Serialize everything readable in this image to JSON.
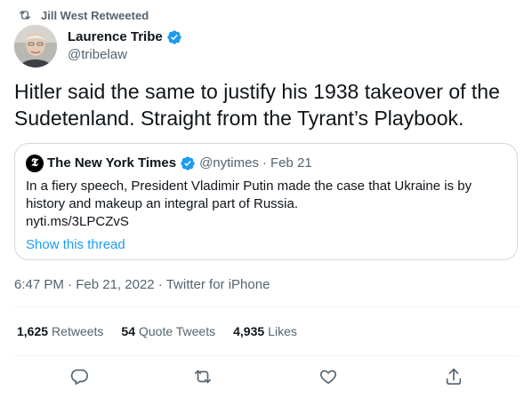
{
  "retweet_context": {
    "text": "Jill West Retweeted",
    "icon": "retweet-icon"
  },
  "author": {
    "name": "Laurence Tribe",
    "handle": "@tribelaw",
    "verified": true,
    "avatar_icon": "avatar-photo"
  },
  "tweet": {
    "text": "Hitler said the same to justify his 1938 takeover of the Sudetenland. Straight from the Tyrant’s Playbook."
  },
  "quote": {
    "logo_glyph": "𝕿",
    "name": "The New York Times",
    "verified": true,
    "handle": "@nytimes",
    "separator": "·",
    "date": "Feb 21",
    "text": "In a fiery speech, President Vladimir Putin made the case that Ukraine is by history and makeup an integral part of Russia.",
    "link": "nyti.ms/3LPCZvS",
    "show_thread": "Show this thread"
  },
  "meta": {
    "time": "6:47 PM",
    "date": "Feb 21, 2022",
    "separator": "·",
    "source": "Twitter for iPhone"
  },
  "stats": [
    {
      "number": "1,625",
      "label": "Retweets"
    },
    {
      "number": "54",
      "label": "Quote Tweets"
    },
    {
      "number": "4,935",
      "label": "Likes"
    }
  ],
  "actions": [
    "reply-icon",
    "retweet-icon",
    "like-icon",
    "share-icon"
  ],
  "colors": {
    "accent": "#1d9bf0",
    "muted": "#536471",
    "text": "#0f1419",
    "border": "#cfd9de"
  }
}
